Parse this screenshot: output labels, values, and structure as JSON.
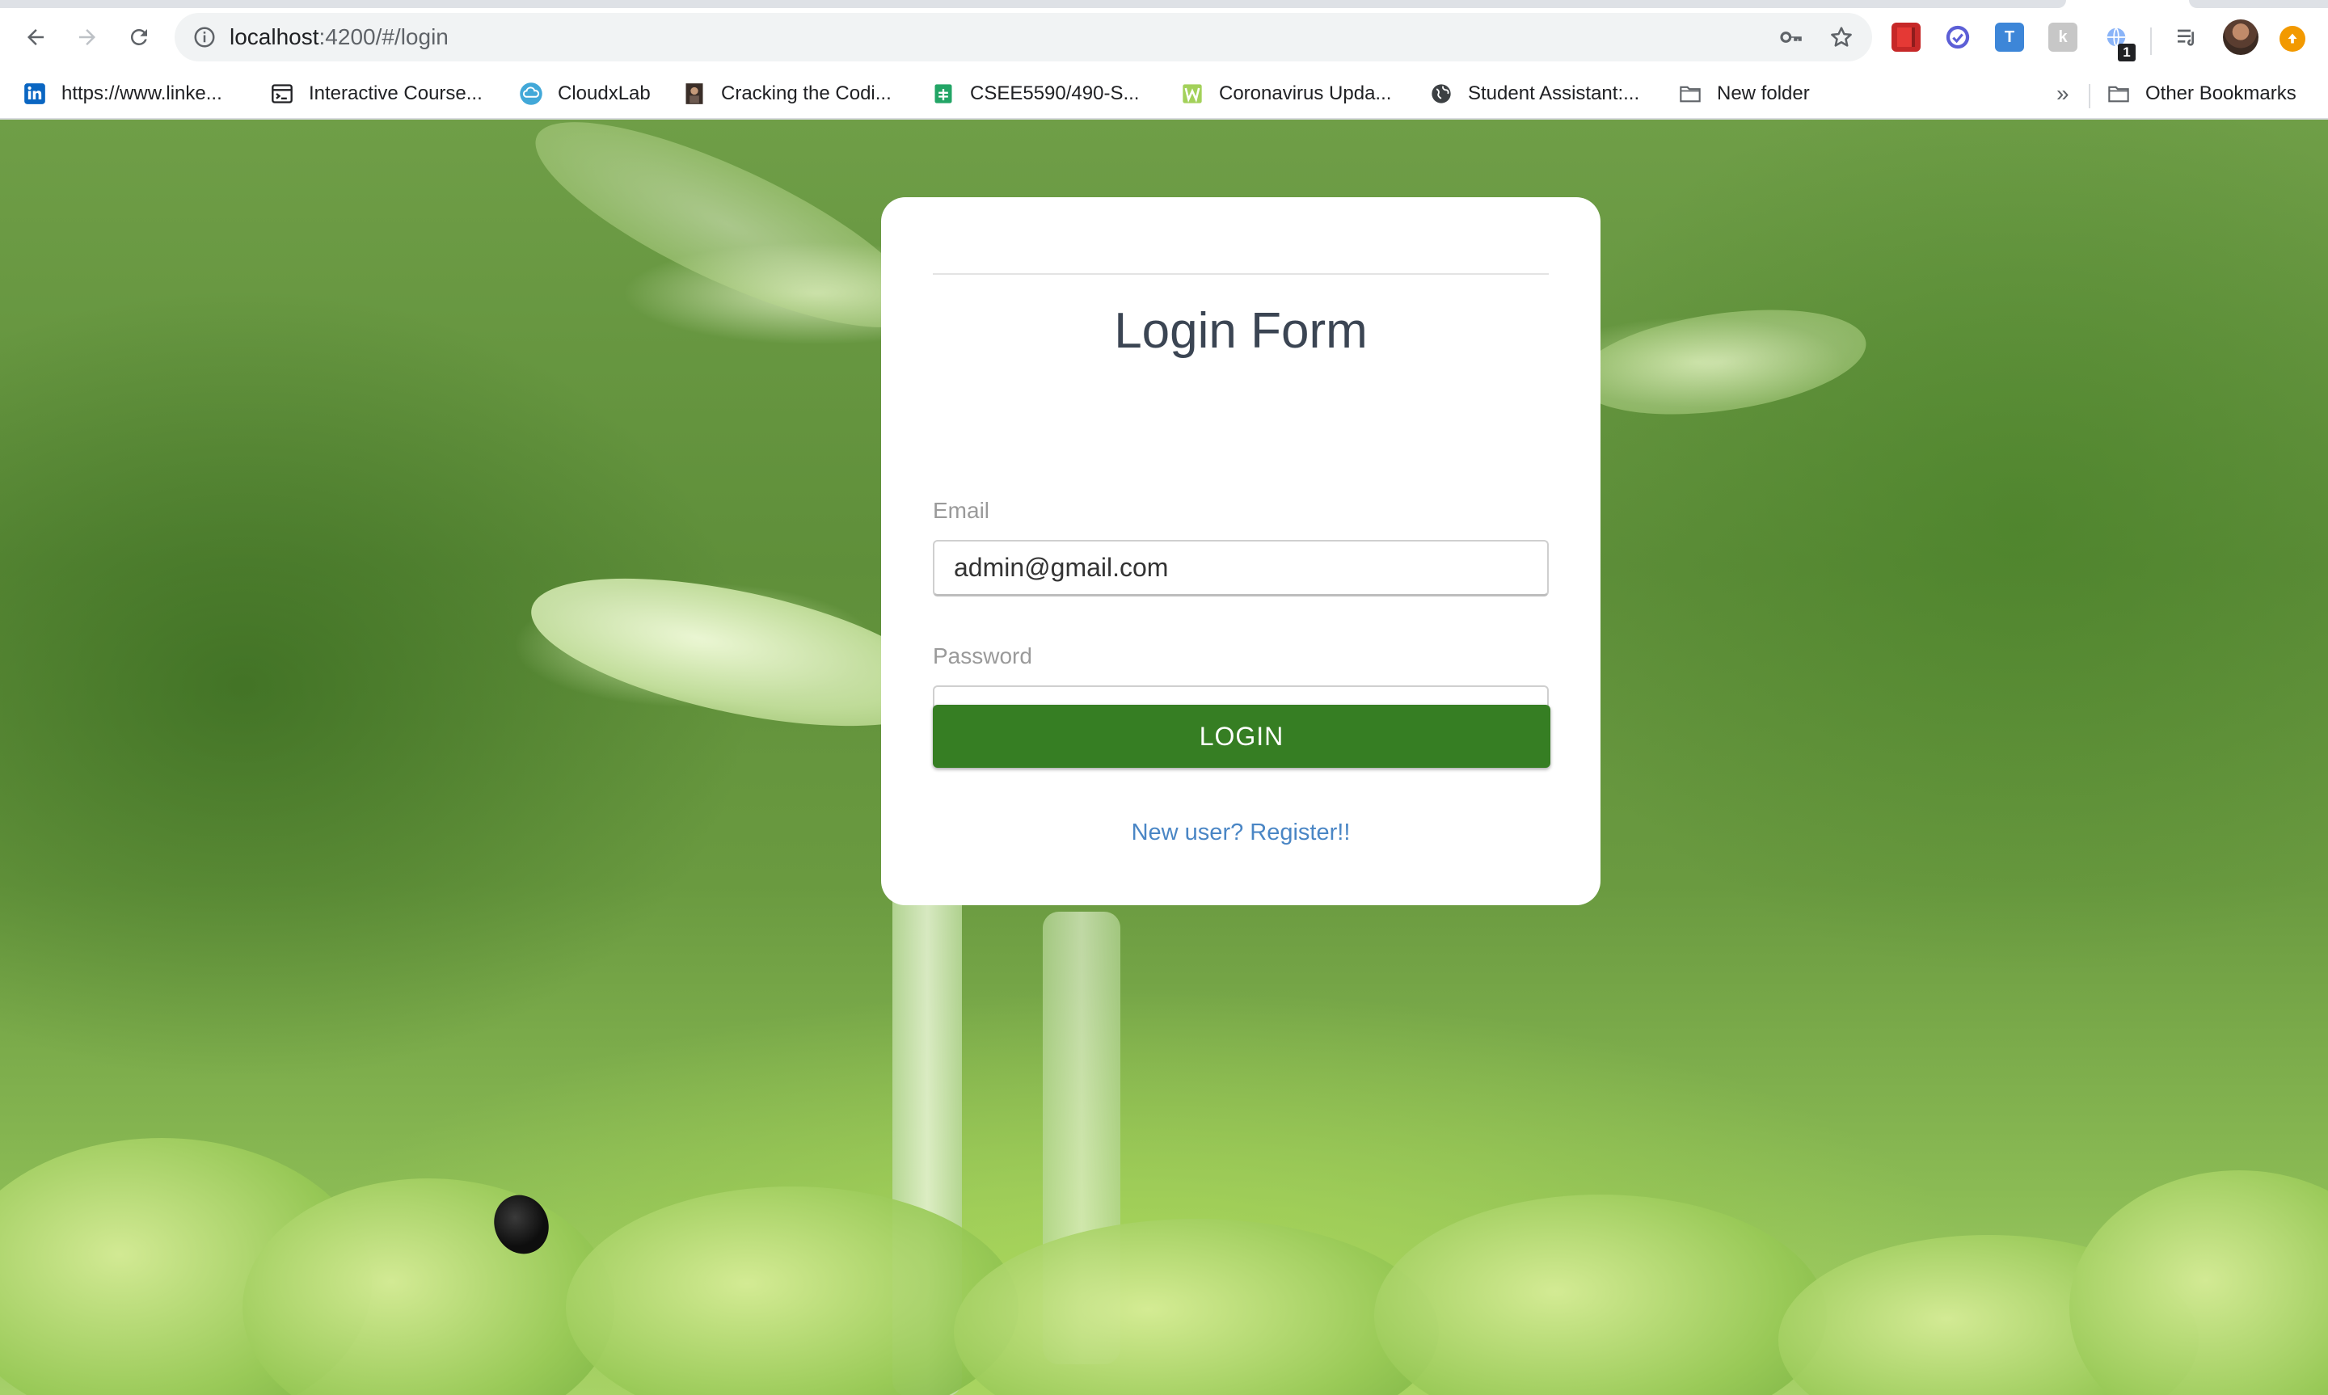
{
  "browser": {
    "url_host": "localhost",
    "url_path": ":4200/#/login",
    "icons": {
      "back": "arrow-left-icon",
      "forward": "arrow-right-icon",
      "reload": "reload-icon",
      "site_info": "info-icon",
      "password_key": "key-icon",
      "bookmark_star": "star-icon",
      "reading_list": "reading-list-icon"
    },
    "extension_badge": "1",
    "bookmarks": [
      {
        "label": "https://www.linke...",
        "icon": "linkedin-icon"
      },
      {
        "label": "Interactive Course...",
        "icon": "terminal-icon"
      },
      {
        "label": "CloudxLab",
        "icon": "cloud-icon"
      },
      {
        "label": "Cracking the Codi...",
        "icon": "book-cover-icon"
      },
      {
        "label": "CSEE5590/490-S...",
        "icon": "sheets-icon"
      },
      {
        "label": "Coronavirus Upda...",
        "icon": "w-logo-icon"
      },
      {
        "label": "Student Assistant:...",
        "icon": "globe-icon"
      },
      {
        "label": "New folder",
        "icon": "folder-icon"
      }
    ],
    "bookmarks_overflow": "»",
    "other_bookmarks": "Other Bookmarks"
  },
  "login": {
    "title": "Login Form",
    "email_label": "Email",
    "email_value": "admin@gmail.com",
    "password_label": "Password",
    "password_value": "••••••",
    "button_label": "LOGIN",
    "register_link": "New user? Register!!"
  },
  "colors": {
    "button_green": "#367e23",
    "link_blue": "#4a86c5",
    "title_text": "#3b4553"
  }
}
